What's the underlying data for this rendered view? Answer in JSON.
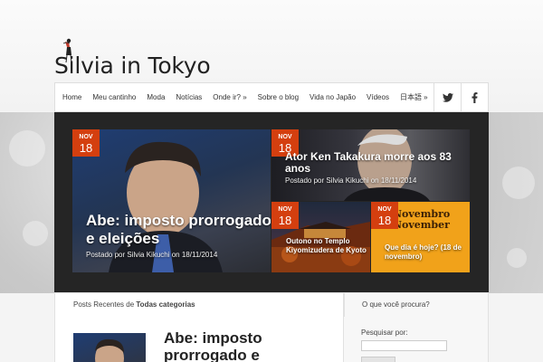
{
  "site": {
    "logo_text": "Silvia in Tokyo"
  },
  "nav": {
    "items": [
      "Home",
      "Meu cantinho",
      "Moda",
      "Notícias",
      "Onde ir? »",
      "Sobre o blog",
      "Vida no Japão",
      "Vídeos",
      "日本語 »"
    ],
    "social": [
      "twitter-icon",
      "facebook-icon"
    ]
  },
  "slider": {
    "main": {
      "month": "NOV",
      "day": "18",
      "title": "Abe: imposto prorrogado e eleições",
      "meta": "Postado por Silvia Kikuchi on 18/11/2014"
    },
    "top_right": {
      "month": "NOV",
      "day": "18",
      "title": "Ator Ken Takakura morre aos 83 anos",
      "meta": "Postado por Silvia Kikuchi on 18/11/2014"
    },
    "bottom_left": {
      "month": "NOV",
      "day": "18",
      "title": "Outono no Templo Kiyomizudera de Kyoto"
    },
    "bottom_right": {
      "month": "NOV",
      "day": "18",
      "title": "Que dia é hoje? (18 de novembro)",
      "image_text": "Novembro November"
    }
  },
  "recent": {
    "prefix": "Posts Recentes de",
    "category": "Todas categorias"
  },
  "post": {
    "title": "Abe: imposto prorrogado e"
  },
  "sidebar": {
    "heading": "O que você procura?",
    "search_label": "Pesquisar por:",
    "search_value": ""
  },
  "colors": {
    "accent": "#d43f0f",
    "link_orange": "#e08a00"
  }
}
